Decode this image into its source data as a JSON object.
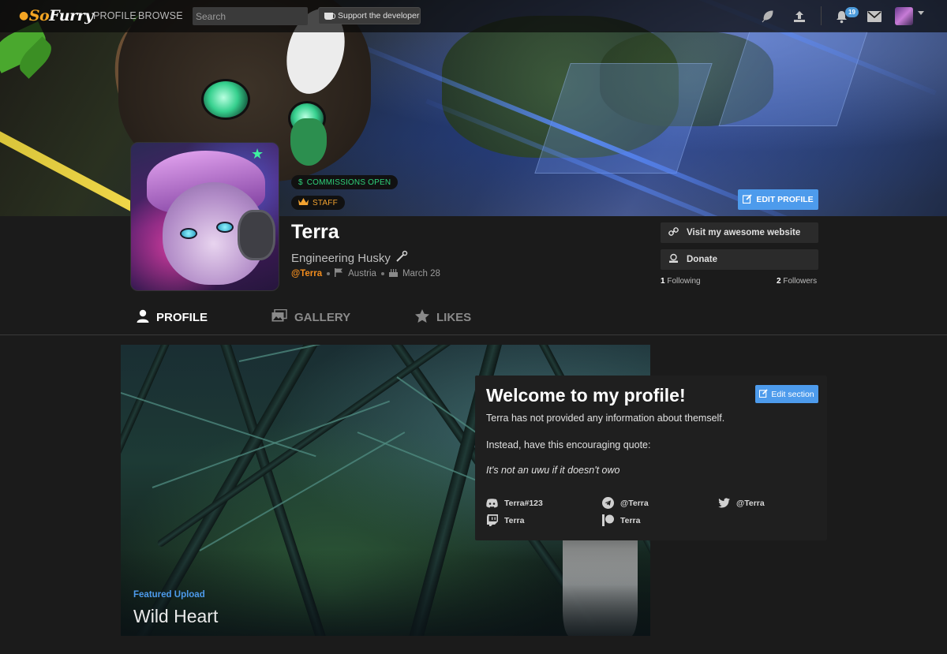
{
  "navbar": {
    "logo_prefix": "So",
    "logo_suffix": "Furry",
    "links": [
      "PROFILE",
      "BROWSE"
    ],
    "search_placeholder": "Search",
    "support_label": "Support the developer",
    "notification_count": "19"
  },
  "profile": {
    "badges": {
      "commissions": "COMMISSIONS OPEN",
      "staff": "STAFF"
    },
    "edit_profile_label": "EDIT PROFILE",
    "name": "Terra",
    "title": "Engineering Husky",
    "handle": "@Terra",
    "location": "Austria",
    "birthday": "March 28",
    "website_label": "Visit my awesome website",
    "donate_label": "Donate",
    "following_count": "1",
    "following_label": "Following",
    "followers_count": "2",
    "followers_label": "Followers"
  },
  "tabs": [
    "PROFILE",
    "GALLERY",
    "LIKES"
  ],
  "featured": {
    "label": "Featured Upload",
    "title": "Wild Heart"
  },
  "welcome": {
    "title": "Welcome to my profile!",
    "edit_label": "Edit section",
    "line1": "Terra has not provided any information about themself.",
    "line2": "Instead, have this encouraging quote:",
    "quote": "It's not an uwu if it doesn't owo",
    "socials": [
      {
        "icon": "discord-icon",
        "text": "Terra#123"
      },
      {
        "icon": "telegram-icon",
        "text": "@Terra"
      },
      {
        "icon": "twitter-icon",
        "text": "@Terra"
      },
      {
        "icon": "twitch-icon",
        "text": "Terra"
      },
      {
        "icon": "patreon-icon",
        "text": "Terra"
      }
    ]
  },
  "colors": {
    "accent": "#4d9bec",
    "handle": "#f28c1d",
    "commissions": "#2fd27a",
    "staff": "#f2a230",
    "background": "#1b1b1b"
  }
}
